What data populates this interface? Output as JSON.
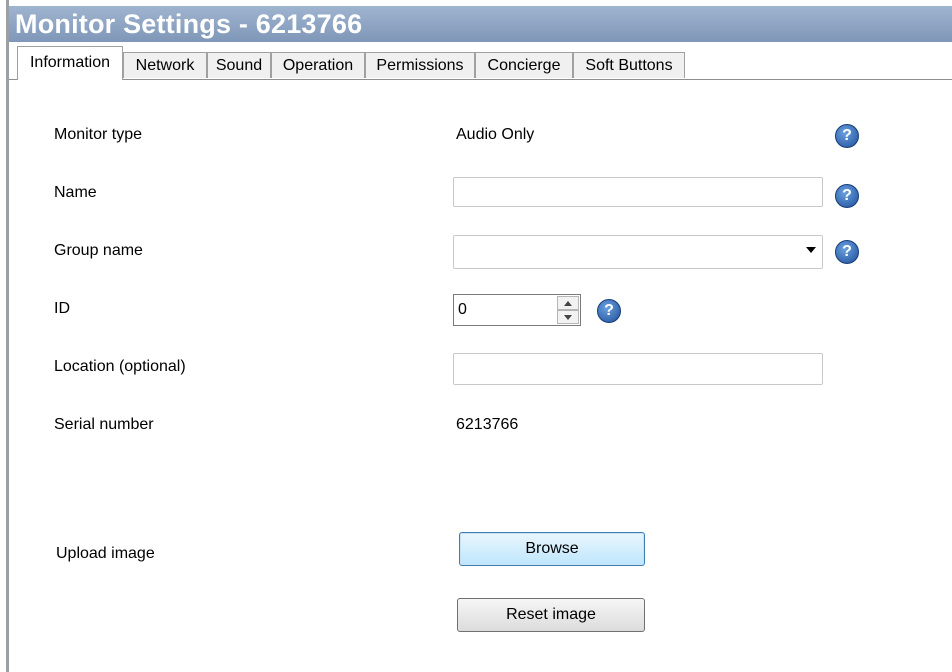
{
  "window": {
    "title": "Monitor Settings - 6213766"
  },
  "tabs": [
    {
      "label": "Information",
      "active": true
    },
    {
      "label": "Network"
    },
    {
      "label": "Sound"
    },
    {
      "label": "Operation"
    },
    {
      "label": "Permissions"
    },
    {
      "label": "Concierge"
    },
    {
      "label": "Soft Buttons"
    }
  ],
  "form": {
    "monitor_type": {
      "label": "Monitor type",
      "value": "Audio Only"
    },
    "name": {
      "label": "Name",
      "value": ""
    },
    "group_name": {
      "label": "Group name",
      "value": ""
    },
    "id": {
      "label": "ID",
      "value": "0"
    },
    "location": {
      "label": "Location (optional)",
      "value": ""
    },
    "serial_number": {
      "label": "Serial number",
      "value": "6213766"
    },
    "upload_image": {
      "label": "Upload image"
    }
  },
  "buttons": {
    "browse": "Browse",
    "reset_image": "Reset image"
  },
  "help_glyph": "?",
  "icons": {
    "help": "question-mark-circle-icon",
    "dropdown": "chevron-down-icon"
  },
  "colors": {
    "titlebar": "#8ea6c6",
    "help_icon": "#2d5fae",
    "focused_button": "#bee6fd"
  }
}
